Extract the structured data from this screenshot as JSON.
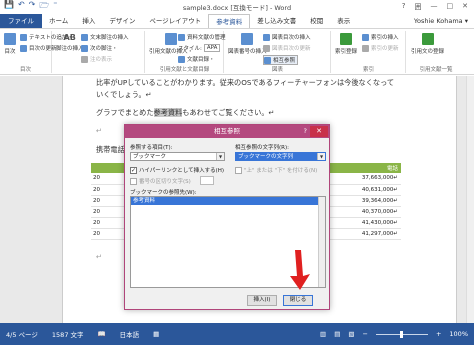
{
  "window": {
    "title": "sample3.docx [互換モード] - Word",
    "controls": [
      "?",
      "囲",
      "—",
      "□",
      "✕"
    ],
    "user": "Yoshie Kohama ▾"
  },
  "quick_access": [
    "💾",
    "↶",
    "↷",
    "🗁",
    "⁼"
  ],
  "tabs": [
    "ファイル",
    "ホーム",
    "挿入",
    "デザイン",
    "ページレイアウト",
    "参考資料",
    "差し込み文書",
    "校閲",
    "表示"
  ],
  "active_tab": "参考資料",
  "ribbon": {
    "groups": [
      "目次",
      "脚注",
      "引用文献と文献目録",
      "図表",
      "索引",
      "引用文献一覧"
    ],
    "toc": {
      "main": "目次",
      "add_text": "テキストの追加・",
      "update": "目次の更新"
    },
    "footnote": {
      "insert_endnote": "文末脚注の挿入",
      "next": "次の脚注・",
      "ab_label": "AB",
      "insert_footnote": "脚注の挿入",
      "show_notes": "注の表示"
    },
    "citations": {
      "insert_citation": "引用文献の挿入・",
      "manage": "資料文献の管理",
      "style_label": "スタイル:",
      "style_value": "APA",
      "bibliography": "文献目録・"
    },
    "captions": {
      "insert_caption": "図表番号の挿入",
      "table_of_figures": "図表目次の挿入",
      "update_table": "図表目次の更新",
      "cross_ref": "相互参照"
    },
    "index": {
      "mark_entry": "索引登録",
      "insert_index": "索引の挿入",
      "update_index": "索引の更新"
    },
    "authorities": {
      "mark_citation": "引用文の登録"
    }
  },
  "document": {
    "line1": "比率がUPしていることがわかります。従来のOSであるフィーチャーフォンは今後なくなって",
    "line2": "いくでしょう。↵",
    "line3_prefix": "グラフでまとめた",
    "line3_highlight": "参考資料",
    "line3_suffix": "もあわせてご覧ください。↵",
    "para_mark": "↵",
    "table_label": "携帯電話",
    "table_header_right": "電話",
    "table_rows": [
      {
        "left": "20",
        "right": "37,663,000↵"
      },
      {
        "left": "20",
        "right": "40,631,000↵"
      },
      {
        "left": "20",
        "right": "39,364,000↵"
      },
      {
        "left": "20",
        "right": "40,370,000↵"
      },
      {
        "left": "20",
        "right": "41,430,000↵"
      },
      {
        "left": "20",
        "right": "41,297,000↵"
      }
    ]
  },
  "dialog": {
    "title": "相互参照",
    "help": "?",
    "close": "✕",
    "ref_type_label": "参照する項目(T):",
    "ref_type_value": "ブックマーク",
    "ref_text_label": "相互参照の文字列(R):",
    "ref_text_value": "ブックマークの文字列",
    "hyperlink_label": "ハイパーリンクとして挿入する(H)",
    "above_below_label": "\"上\" または \"下\" を付ける(N)",
    "separator_label": "番号の区切り文字(S)",
    "list_label": "ブックマークの参照先(W):",
    "list_items": [
      "参考資料"
    ],
    "insert_button": "挿入(I)",
    "close_button": "閉じる"
  },
  "statusbar": {
    "page": "4/5 ページ",
    "words": "1587 文字",
    "lang": "日本語",
    "zoom": "100%"
  }
}
